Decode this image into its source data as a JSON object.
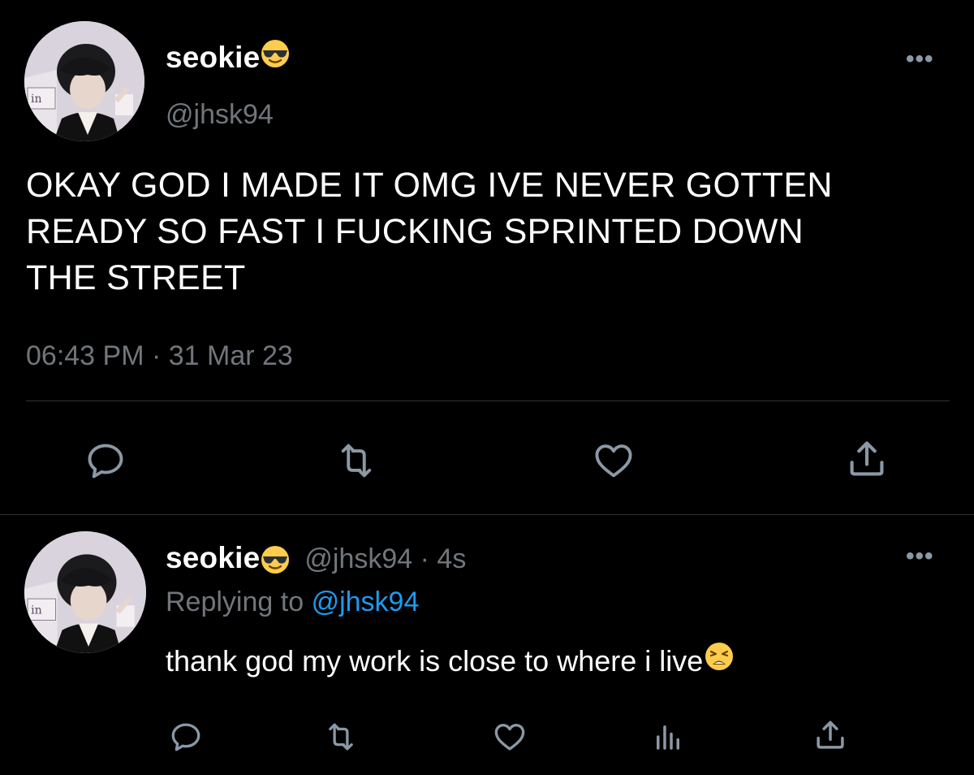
{
  "main_tweet": {
    "display_name": "seokie",
    "handle": "@jhsk94",
    "text": "OKAY GOD I MADE IT OMG IVE NEVER GOTTEN READY SO FAST I FUCKING SPRINTED DOWN THE STREET",
    "text_lines": [
      "OKAY GOD I MADE IT OMG IVE NEVER GOTTEN",
      "READY SO FAST I FUCKING SPRINTED DOWN",
      "THE STREET"
    ],
    "timestamp": "06:43 PM · 31 Mar 23",
    "name_emoji": "smiling-face-with-sunglasses"
  },
  "reply_tweet": {
    "display_name": "seokie",
    "handle_time": "@jhsk94 · 4s",
    "replying_prefix": "Replying to",
    "replying_handle": "@jhsk94",
    "text": "thank god my work is close to where i live",
    "text_emoji": "weary-face",
    "name_emoji": "smiling-face-with-sunglasses"
  },
  "more_label": "•••",
  "icons": [
    "reply-icon",
    "retweet-icon",
    "like-icon",
    "share-icon",
    "analytics-icon"
  ],
  "colors": {
    "background": "#000000",
    "text": "#ffffff",
    "secondary": "#71767b",
    "link": "#1d9bf0",
    "divider": "#2f3336",
    "icon": "#8b98a5"
  }
}
